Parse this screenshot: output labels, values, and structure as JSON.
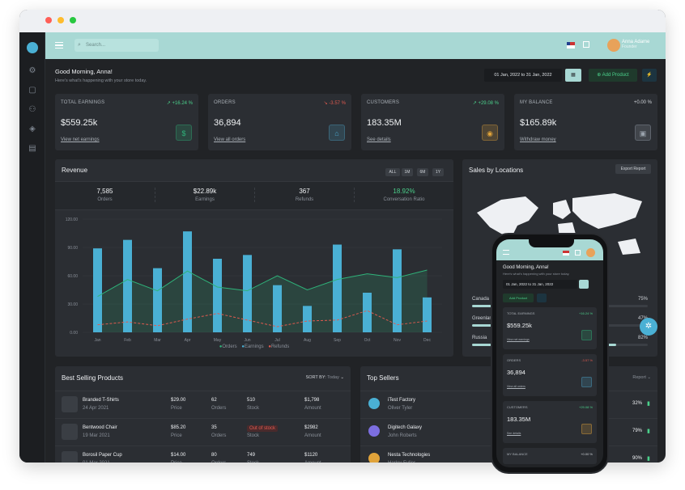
{
  "browser": {
    "dot_colors": [
      "#ff5f57",
      "#febc2e",
      "#28c840"
    ]
  },
  "topbar": {
    "search_placeholder": "Search...",
    "user_name": "Anna Adame",
    "user_role": "Founder"
  },
  "greeting": {
    "title": "Good Morning, Anna!",
    "subtitle": "Here's what's happening with your store today."
  },
  "toolbar": {
    "date_range": "01 Jan, 2022 to 31 Jan, 2022",
    "add_product": "Add Product"
  },
  "stats": [
    {
      "title": "TOTAL EARNINGS",
      "pct": "+16.24 %",
      "trend": "up",
      "value": "$559.25k",
      "link": "View net earnings",
      "color": "#2fb37a"
    },
    {
      "title": "ORDERS",
      "pct": "-3.57 %",
      "trend": "down",
      "value": "36,894",
      "link": "View all orders",
      "color": "#4aa3c7"
    },
    {
      "title": "CUSTOMERS",
      "pct": "+29.08 %",
      "trend": "up",
      "value": "183.35M",
      "link": "See details",
      "color": "#e0a33a"
    },
    {
      "title": "MY BALANCE",
      "pct": "+0.00 %",
      "trend": "flat",
      "value": "$165.89k",
      "link": "Withdraw money",
      "color": "#9aa3ad"
    }
  ],
  "revenue": {
    "title": "Revenue",
    "ranges": [
      "ALL",
      "1M",
      "6M",
      "1Y"
    ],
    "summary": [
      {
        "value": "7,585",
        "label": "Orders"
      },
      {
        "value": "$22.89k",
        "label": "Earnings"
      },
      {
        "value": "367",
        "label": "Refunds"
      },
      {
        "value": "18.92%",
        "label": "Conversation Ratio"
      }
    ],
    "legend": [
      "Orders",
      "Earnings",
      "Refunds"
    ]
  },
  "chart_data": {
    "type": "bar",
    "categories": [
      "Jan",
      "Feb",
      "Mar",
      "Apr",
      "May",
      "Jun",
      "Jul",
      "Aug",
      "Sep",
      "Oct",
      "Nov",
      "Dec"
    ],
    "y_ticks": [
      "0.00",
      "30.00",
      "60.00",
      "90.00",
      "120.00"
    ],
    "ylim": [
      0,
      120
    ],
    "series": [
      {
        "name": "Earnings",
        "type": "bar",
        "values": [
          89,
          98,
          68,
          107,
          78,
          82,
          50,
          28,
          93,
          42,
          88,
          37
        ]
      },
      {
        "name": "Orders",
        "type": "area",
        "values": [
          38,
          56,
          44,
          65,
          48,
          44,
          60,
          45,
          56,
          62,
          58,
          66
        ]
      },
      {
        "name": "Refunds",
        "type": "line",
        "values": [
          8,
          11,
          7,
          14,
          20,
          13,
          6,
          12,
          13,
          23,
          8,
          12
        ]
      }
    ],
    "grid": true,
    "legend": "bottom"
  },
  "locations": {
    "title": "Sales by Locations",
    "export": "Export Report",
    "items": [
      {
        "name": "Canada",
        "pct": "75%",
        "fill": 0.75
      },
      {
        "name": "Greenland",
        "pct": "47%",
        "fill": 0.47
      },
      {
        "name": "Russia",
        "pct": "82%",
        "fill": 0.82
      }
    ]
  },
  "products": {
    "title": "Best Selling Products",
    "sort_label": "SORT BY:",
    "sort_value": "Today",
    "rows": [
      {
        "name": "Branded T-Shirts",
        "date": "24 Apr 2021",
        "price": "$29.00",
        "orders": "62",
        "stock": "510",
        "amount": "$1,798"
      },
      {
        "name": "Bentwood Chair",
        "date": "19 Mar 2021",
        "price": "$85.20",
        "orders": "35",
        "stock": "Out of stock",
        "amount": "$2982"
      },
      {
        "name": "Borosil Paper Cup",
        "date": "01 Mar 2021",
        "price": "$14.00",
        "orders": "80",
        "stock": "749",
        "amount": "$1120"
      }
    ],
    "col_labels": [
      "Price",
      "Orders",
      "Stock",
      "Amount"
    ]
  },
  "sellers": {
    "title": "Top Sellers",
    "report": "Report",
    "rows": [
      {
        "name": "iTest Factory",
        "owner": "Oliver Tyler",
        "pct": "32%"
      },
      {
        "name": "Digitech Galaxy",
        "owner": "John Roberts",
        "pct": "79%"
      },
      {
        "name": "Nesta Technologies",
        "owner": "Harley Fuller",
        "pct": "90%"
      }
    ]
  },
  "phone": {
    "greeting": "Good Morning, Anna!",
    "subtitle": "Here's what's happening with your store today.",
    "date_range": "01 Jan, 2022 to 31 Jan, 2022",
    "add_product": "Add Product",
    "cards": [
      {
        "title": "TOTAL EARNINGS",
        "pct": "+16.24 %",
        "value": "$559.25k",
        "link": "View net earnings"
      },
      {
        "title": "ORDERS",
        "pct": "-3.57 %",
        "value": "36,894",
        "link": "View all orders"
      },
      {
        "title": "CUSTOMERS",
        "pct": "+29.08 %",
        "value": "183.35M",
        "link": "See details"
      },
      {
        "title": "MY BALANCE",
        "pct": "+0.00 %"
      }
    ]
  }
}
